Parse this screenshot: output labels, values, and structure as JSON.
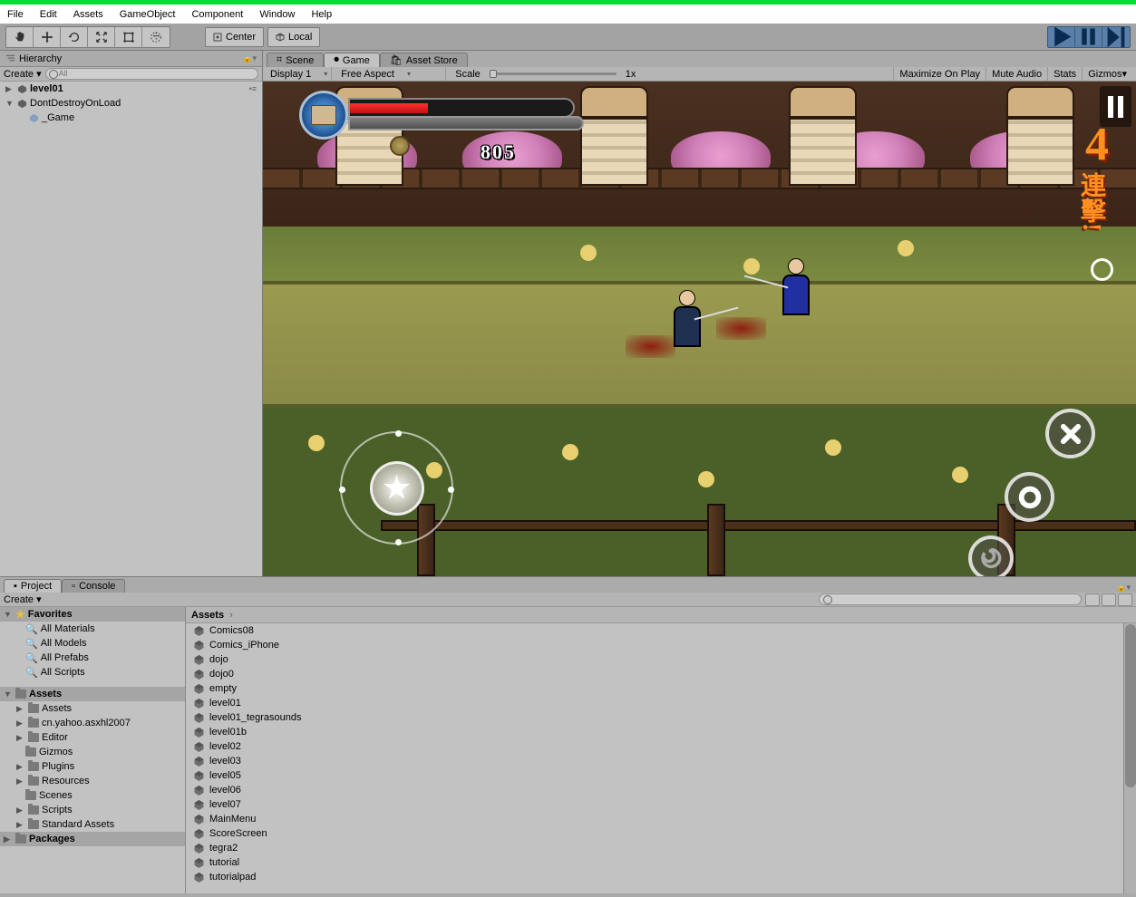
{
  "menubar": {
    "file": "File",
    "edit": "Edit",
    "assets": "Assets",
    "gameObject": "GameObject",
    "component": "Component",
    "window": "Window",
    "help": "Help"
  },
  "toolbar": {
    "center": "Center",
    "local": "Local"
  },
  "hierarchy": {
    "title": "Hierarchy",
    "create": "Create",
    "searchPlaceholder": "All",
    "items": [
      {
        "label": "level01",
        "depth": 0,
        "arrow": true,
        "bold": true
      },
      {
        "label": "DontDestroyOnLoad",
        "depth": 0,
        "arrow": true
      },
      {
        "label": "_Game",
        "depth": 1
      }
    ]
  },
  "gamePanel": {
    "tabs": [
      {
        "label": "Scene"
      },
      {
        "label": "Game",
        "active": true
      },
      {
        "label": "Asset Store"
      }
    ],
    "display": "Display 1",
    "aspect": "Free Aspect",
    "scaleLabel": "Scale",
    "scaleValue": "1x",
    "rightBtns": [
      "Maximize On Play",
      "Mute Audio",
      "Stats",
      "Gizmos"
    ]
  },
  "gameHUD": {
    "score": "805",
    "comboNum": "4",
    "comboText": "連擊!"
  },
  "project": {
    "tabs": [
      {
        "label": "Project",
        "active": true
      },
      {
        "label": "Console"
      }
    ],
    "create": "Create",
    "favorites": {
      "header": "Favorites",
      "items": [
        "All Materials",
        "All Models",
        "All Prefabs",
        "All Scripts"
      ]
    },
    "assetsHeader": "Assets",
    "folders": [
      "Assets",
      "cn.yahoo.asxhl2007",
      "Editor",
      "Gizmos",
      "Plugins",
      "Resources",
      "Scenes",
      "Scripts",
      "Standard Assets"
    ],
    "packagesHeader": "Packages",
    "breadcrumb": "Assets",
    "assetItems": [
      "Comics08",
      "Comics_iPhone",
      "dojo",
      "dojo0",
      "empty",
      "level01",
      "level01_tegrasounds",
      "level01b",
      "level02",
      "level03",
      "level05",
      "level06",
      "level07",
      "MainMenu",
      "ScoreScreen",
      "tegra2",
      "tutorial",
      "tutorialpad"
    ]
  }
}
